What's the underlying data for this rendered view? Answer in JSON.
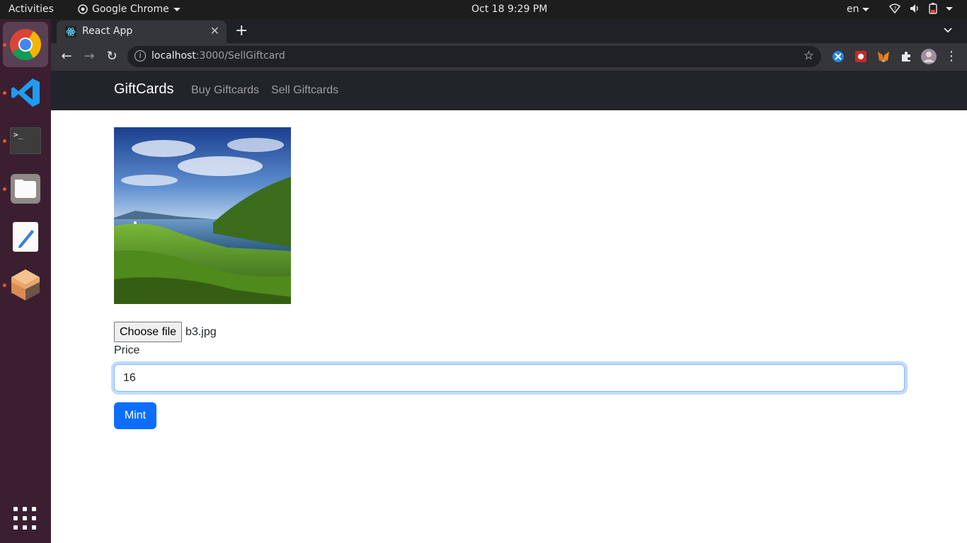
{
  "system_bar": {
    "activities": "Activities",
    "app_name": "Google Chrome",
    "clock": "Oct 18  9:29 PM",
    "language": "en"
  },
  "dock": {
    "items": [
      "chrome-icon",
      "vscode-icon",
      "terminal-icon",
      "files-icon",
      "text-editor-icon",
      "package-icon"
    ],
    "apps_grid": "show-applications-icon"
  },
  "browser": {
    "tab_title": "React App",
    "url_host": "localhost",
    "url_path": ":3000/SellGiftcard"
  },
  "navbar": {
    "brand": "GiftCards",
    "links": [
      "Buy Giftcards",
      "Sell Giftcards"
    ],
    "bg_color": "#212529"
  },
  "form": {
    "choose_file_label": "Choose file",
    "file_name": "b3.jpg",
    "price_label": "Price",
    "price_value": "16",
    "submit_label": "Mint",
    "accent_color": "#0d6efd"
  }
}
